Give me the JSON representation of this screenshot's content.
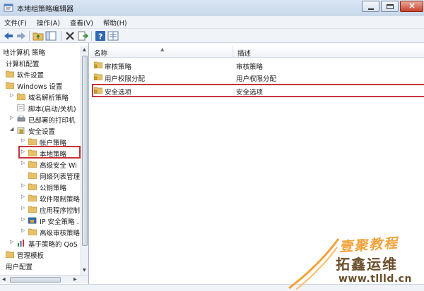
{
  "window": {
    "title": "本地组策略编辑器"
  },
  "menu": [
    "文件(F)",
    "操作(A)",
    "查看(V)",
    "帮助(H)"
  ],
  "tree": {
    "root_label": "地计算机 策略",
    "items": [
      {
        "label": "计算机配置"
      },
      {
        "label": "软件设置"
      },
      {
        "label": "Windows 设置"
      },
      {
        "label": "域名解析策略"
      },
      {
        "label": "脚本(启动/关机)"
      },
      {
        "label": "已部署的打印机"
      },
      {
        "label": "安全设置"
      },
      {
        "label": "帐户策略"
      },
      {
        "label": "本地策略"
      },
      {
        "label": "高级安全 Wi"
      },
      {
        "label": "网络列表管理"
      },
      {
        "label": "公钥策略"
      },
      {
        "label": "软件限制策略"
      },
      {
        "label": "应用程序控制"
      },
      {
        "label": "IP 安全策略 ."
      },
      {
        "label": "高级审核策略"
      },
      {
        "label": "基于策略的 QoS"
      },
      {
        "label": "管理模板"
      },
      {
        "label": "用户配置"
      }
    ]
  },
  "list": {
    "columns": {
      "name": "名称",
      "description": "描述"
    },
    "rows": [
      {
        "name": "审核策略",
        "description": "审核策略"
      },
      {
        "name": "用户权限分配",
        "description": "用户权限分配"
      },
      {
        "name": "安全选项",
        "description": "安全选项"
      }
    ]
  },
  "watermark": {
    "line1": "壹聚教程",
    "line2": "拓鑫运维",
    "line3": "www.tllld.cn"
  },
  "colors": {
    "highlight": "#c8323a",
    "folder": "#e8c06a",
    "accent": "#2f6ab3"
  }
}
